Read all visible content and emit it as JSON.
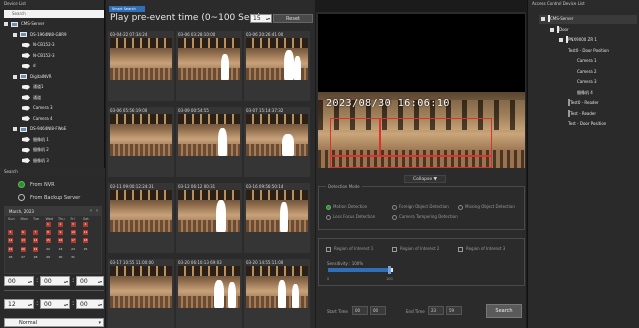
{
  "device_list": {
    "title": "Device List",
    "search_placeholder": "Search",
    "tree": [
      {
        "label": "CMS-Server",
        "level": 0,
        "icon": "server-icon"
      },
      {
        "label": "DS-1964NI8-G8R9",
        "level": 1,
        "icon": "nvr-icon"
      },
      {
        "label": "N-CB152-3",
        "level": 2,
        "icon": "camera-icon"
      },
      {
        "label": "N-CB152-3",
        "level": 2,
        "icon": "camera-icon"
      },
      {
        "label": "d",
        "level": 2,
        "icon": "camera-icon"
      },
      {
        "label": "DigitalNVR",
        "level": 1,
        "icon": "nvr-icon"
      },
      {
        "label": "通道1",
        "level": 2,
        "icon": "camera-icon"
      },
      {
        "label": "通道",
        "level": 2,
        "icon": "camera-icon"
      },
      {
        "label": "Camera 3",
        "level": 2,
        "icon": "camera-icon"
      },
      {
        "label": "Camera 4",
        "level": 2,
        "icon": "camera-icon"
      },
      {
        "label": "DS-9464NI8-FWoE",
        "level": 1,
        "icon": "nvr-icon"
      },
      {
        "label": "摄像机 1",
        "level": 2,
        "icon": "camera-icon"
      },
      {
        "label": "摄像机 2",
        "level": 2,
        "icon": "camera-icon"
      },
      {
        "label": "摄像机 3",
        "level": 2,
        "icon": "camera-icon"
      }
    ]
  },
  "search": {
    "title": "Search",
    "source_options": [
      "From NVR",
      "From Backup Server"
    ],
    "selected_source": "From NVR",
    "calendar": {
      "month_label": "March, 2023",
      "weekdays": [
        "Sun",
        "Mon",
        "Tue",
        "Wed",
        "Thu",
        "Fri",
        "Sat"
      ],
      "days": [
        "1",
        "2",
        "3",
        "4",
        "5",
        "6",
        "7",
        "8",
        "9",
        "10",
        "11",
        "12",
        "13",
        "14",
        "15",
        "16",
        "17",
        "18",
        "19",
        "20",
        "21",
        "22",
        "23",
        "24",
        "25",
        "26",
        "27",
        "28",
        "29",
        "30",
        "31"
      ],
      "recorded_days": [
        "1",
        "2",
        "3",
        "4",
        "5",
        "6",
        "7",
        "8",
        "9",
        "10",
        "11",
        "12",
        "13",
        "14",
        "15",
        "16",
        "17",
        "18",
        "19",
        "20",
        "21"
      ]
    },
    "start_time": {
      "h": "00",
      "m": "00",
      "s": "00"
    },
    "end_time": {
      "h": "12",
      "m": "00",
      "s": "00"
    },
    "mode": "Normal"
  },
  "smart_search": {
    "tab_label": "Smart Search",
    "pre_event_label": "Play pre-event time (0~100 Sec.)",
    "pre_event_value": "15",
    "reset_label": "Reset",
    "thumbnails": [
      {
        "ts": "03-04-22 07:34:24"
      },
      {
        "ts": "03-06 03:28:10:00"
      },
      {
        "ts": "03-06 20:26:41 00"
      },
      {
        "ts": "03-06 05:56:19:00"
      },
      {
        "ts": "03-09 00:54:55"
      },
      {
        "ts": "03-07 15:14:37:32"
      },
      {
        "ts": "03-11 09:00:12:24:31"
      },
      {
        "ts": "03-12 06:12 00:31"
      },
      {
        "ts": "03-16 09:56:50:14"
      },
      {
        "ts": "03-17 10:55 11:00:00"
      },
      {
        "ts": "03-20 06:10:13 69:03"
      },
      {
        "ts": "03-20 14:55:11:00"
      }
    ]
  },
  "video": {
    "osd_timestamp": "2023/08/30  16:06:10",
    "collapse_label": "Collapse ▼"
  },
  "detection": {
    "title": "Detection Mode",
    "options": [
      "Motion Detection",
      "Foreign Object Detection",
      "Missing Object Detection",
      "Loss Focus Detection",
      "Camera Tampering Detection"
    ],
    "selected": "Motion Detection"
  },
  "regions": {
    "items": [
      "Region of Interest 1",
      "Region of Interest 2",
      "Region of Interest 3"
    ],
    "sensitivity_label": "Sensitivity : 100%",
    "sensitivity": 100,
    "tick_min": "0",
    "tick_max": "100"
  },
  "time_filter": {
    "start_label": "Start Time",
    "end_label": "End Time",
    "search_label": "Search"
  },
  "access_control": {
    "title": "Access Control Device List",
    "tree": [
      {
        "label": "CMS-Server",
        "level": 0,
        "icon": "server-icon"
      },
      {
        "label": "Door",
        "level": 1,
        "icon": "door-group-icon"
      },
      {
        "label": "PNX9000 ZR 1",
        "level": 2,
        "icon": "controller-icon"
      },
      {
        "label": "Test0 - Door Position",
        "level": 3,
        "icon": "door-icon"
      },
      {
        "label": "Camera 1",
        "level": 4,
        "icon": "camera-icon"
      },
      {
        "label": "Camera 2",
        "level": 4,
        "icon": "camera-icon"
      },
      {
        "label": "Camera 3",
        "level": 4,
        "icon": "camera-icon"
      },
      {
        "label": "摄像机 4",
        "level": 4,
        "icon": "camera-icon"
      },
      {
        "label": "Test0 - Reader",
        "level": 3,
        "icon": "reader-icon"
      },
      {
        "label": "Test - Reader",
        "level": 3,
        "icon": "reader-icon"
      },
      {
        "label": "Test - Door Position",
        "level": 3,
        "icon": "door-icon"
      }
    ]
  }
}
